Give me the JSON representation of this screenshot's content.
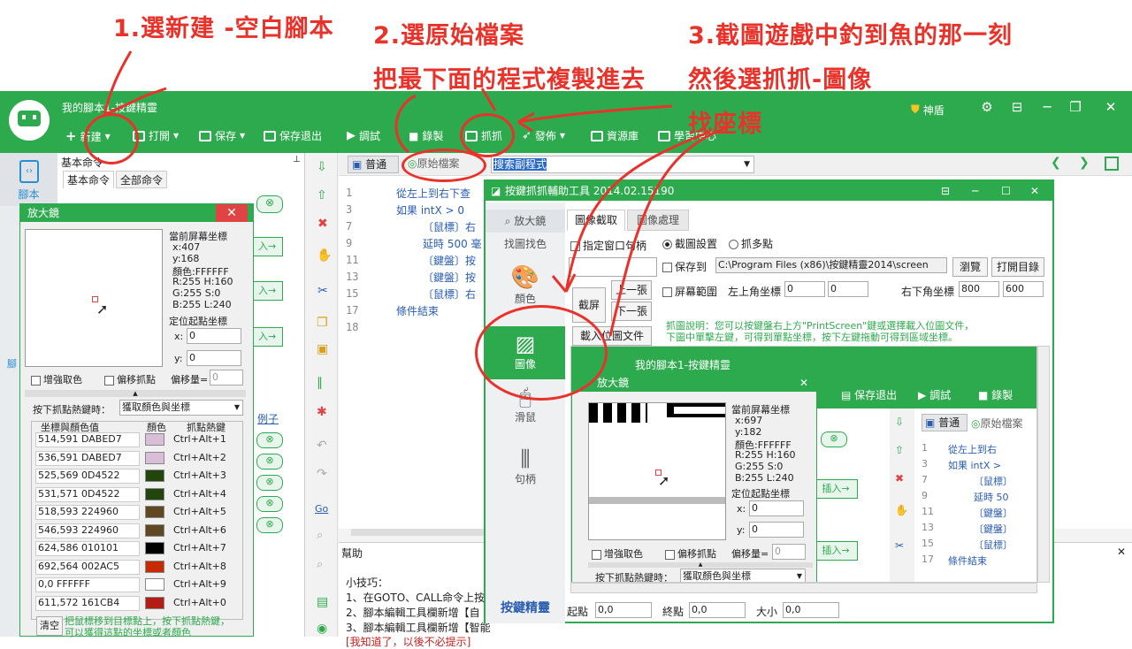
{
  "annotations": {
    "step1": "1.選新建 -空白腳本",
    "step2a": "2.選原始檔案",
    "step2b": "把最下面的程式複製進去",
    "step3a": "3.截圖遊戲中釣到魚的那一刻",
    "step3b": "然後選抓抓-圖像",
    "coord": "找座標"
  },
  "main": {
    "title": "我的腳本1-按鍵精靈",
    "shield": "神盾",
    "toolbar": [
      "新建",
      "打開",
      "保存",
      "保存退出",
      "調試",
      "錄製",
      "抓抓",
      "發佈",
      "資源庫",
      "學習中心"
    ],
    "nav_script": "腳本",
    "nav_cut": "腳",
    "cmd_title": "基本命令",
    "cmd_tabs": [
      "基本命令",
      "全部命令"
    ],
    "cmd_examples": "例子",
    "btn_insert": "入→",
    "editor_tabs": [
      "普通",
      "原始檔案"
    ],
    "search": "搜索副程式",
    "code": {
      "lines": [
        "1",
        "3",
        "7",
        "9",
        "11",
        "13",
        "15",
        "17",
        "18"
      ],
      "l1": "從左上到右下查",
      "l3": "如果 intX > 0",
      "l7": "〔鼠標〕右",
      "l9": "延時 500 毫",
      "l11": "〔鍵盤〕按",
      "l13": "〔鍵盤〕按",
      "l15": "〔鼠標〕右",
      "l17": "條件結束"
    },
    "help_title": "幫助",
    "help_lines": [
      "小技巧：",
      "1、在GOTO、CALL命令上按",
      "2、腳本編輯工具欄新增【自",
      "3、腳本編輯工具欄新增【智能",
      "[我知道了，以後不必提示]"
    ]
  },
  "mag1": {
    "title": "放大鏡",
    "close": "✕",
    "cur": "當前屏幕坐標",
    "x": "x:407",
    "y": "y:168",
    "color": "顏色:FFFFFF",
    "r": "R:255  H:160",
    "g": "G:255  S:0",
    "b": "B:255  L:240",
    "locate": "定位起點坐標",
    "lx": "x:",
    "ly": "y:",
    "vx": "0",
    "vy": "0",
    "enh": "增強取色",
    "off": "偏移抓點",
    "offv": "偏移量=",
    "offn": "0",
    "hotkey": "按下抓點熱鍵時：",
    "hotsel": "獲取顏色與坐標",
    "cols": [
      "坐標與顏色值",
      "顏色",
      "抓點熱鍵"
    ],
    "rows": [
      {
        "v": "514,591  DABED7",
        "c": "#dabed7",
        "k": "Ctrl+Alt+1"
      },
      {
        "v": "536,591  DABED7",
        "c": "#dabed7",
        "k": "Ctrl+Alt+2"
      },
      {
        "v": "525,569  0D4522",
        "c": "#22450d",
        "k": "Ctrl+Alt+3"
      },
      {
        "v": "531,571  0D4522",
        "c": "#22450d",
        "k": "Ctrl+Alt+4"
      },
      {
        "v": "518,593  224960",
        "c": "#604922",
        "k": "Ctrl+Alt+5"
      },
      {
        "v": "546,593  224960",
        "c": "#604922",
        "k": "Ctrl+Alt+6"
      },
      {
        "v": "624,586  010101",
        "c": "#010101",
        "k": "Ctrl+Alt+7"
      },
      {
        "v": "692,564  002AC5",
        "c": "#c52a00",
        "k": "Ctrl+Alt+8"
      },
      {
        "v": "0,0  FFFFFF",
        "c": "#ffffff",
        "k": "Ctrl+Alt+9"
      },
      {
        "v": "611,572  161CB4",
        "c": "#b41c16",
        "k": "Ctrl+Alt+0"
      }
    ],
    "clear": "清空",
    "tip1": "把鼠標移到目標點上，按下抓點熱鍵，",
    "tip2": "可以獲得這點的坐標或者顏色"
  },
  "helper": {
    "title": "按鍵抓抓輔助工具 2014.02.15190",
    "nav": [
      "放大鏡",
      "找圖找色",
      "顏色",
      "圖像",
      "滑鼠",
      "句柄"
    ],
    "tabs": [
      "圖像截取",
      "圖像處理"
    ],
    "chk_window": "指定窗口句柄",
    "radio1": "截圖設置",
    "radio2": "抓多點",
    "save_to": "保存到",
    "path": "C:\\Program Files (x86)\\按鍵精靈2014\\screen",
    "browse": "瀏覽",
    "open_dir": "打開目錄",
    "screen_range": "屏幕範圍",
    "tl": "左上角坐標",
    "tlx": "0",
    "tly": "0",
    "br": "右下角坐標",
    "brx": "800",
    "bry": "600",
    "capture": "截屏",
    "prev": "上一張",
    "next": "下一張",
    "load": "載入位圖文件",
    "desc1": "抓圖說明：您可以按鍵盤右上方\"PrintScreen\"鍵或選擇載入位圖文件，",
    "desc2": "下圖中單擊左鍵，可得到單點坐標，按下左鍵拖動可得到區域坐標。",
    "brand": "按鍵精靈",
    "start": "起點",
    "startv": "0,0",
    "end": "終點",
    "endv": "0,0",
    "size": "大小",
    "sizev": "0,0"
  },
  "inner": {
    "title": "我的腳本1-按鍵精靈",
    "save_exit": "保存退出",
    "debug": "調試",
    "record": "錄製",
    "tab_normal": "普通",
    "tab_raw": "原始檔案",
    "lines": [
      "1",
      "3",
      "7",
      "9",
      "11",
      "13",
      "15",
      "17"
    ],
    "code": [
      "從左上到右",
      "如果 intX >",
      "〔鼠標〕",
      "延時 50",
      "〔鍵盤〕",
      "〔鍵盤〕",
      "〔鼠標〕",
      "條件結束"
    ],
    "insert": "插入→"
  },
  "mag2": {
    "title": "放大鏡",
    "close": "✕",
    "cur": "當前屏幕坐標",
    "x": "x:697",
    "y": "y:182",
    "color": "顏色:FFFFFF",
    "r": "R:255  H:160",
    "g": "G:255  S:0",
    "b": "B:255  L:240",
    "locate": "定位起點坐標",
    "lx": "x:",
    "ly": "y:",
    "vx": "0",
    "vy": "0",
    "enh": "增強取色",
    "off": "偏移抓點",
    "offv": "偏移量=",
    "offn": "0",
    "hotkey": "按下抓點熱鍵時：",
    "hotsel": "獲取顏色與坐標"
  }
}
